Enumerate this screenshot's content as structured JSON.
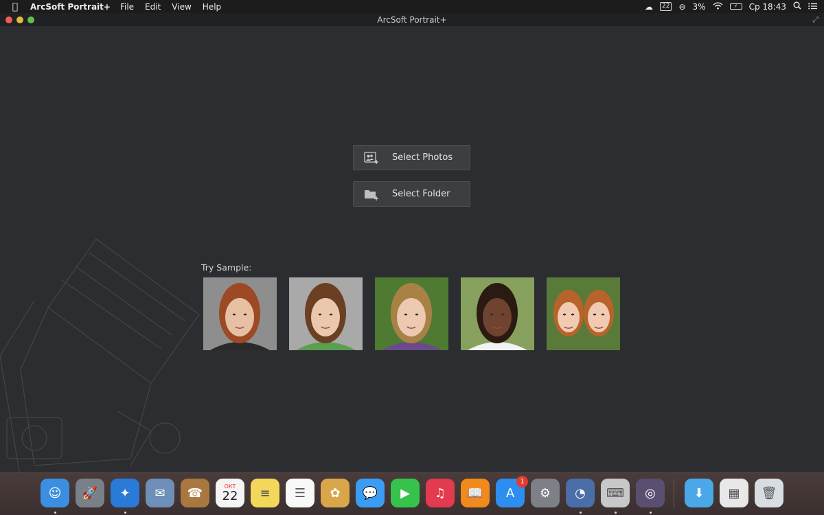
{
  "menubar": {
    "apple_icon": "",
    "app_name": "ArcSoft Portrait+",
    "menus": [
      "File",
      "Edit",
      "View",
      "Help"
    ],
    "status": {
      "calendar_badge": "22",
      "battery_percent": "3%",
      "clock": "Ср 18:43"
    }
  },
  "window": {
    "title": "ArcSoft Portrait+"
  },
  "main": {
    "select_photos_label": "Select Photos",
    "select_folder_label": "Select Folder",
    "try_sample_label": "Try Sample:",
    "samples": [
      {
        "name": "sample-woman-red-hair",
        "bg": "#8e8e8e",
        "hair": "#9c4a26",
        "skin": "#e7c0a3"
      },
      {
        "name": "sample-boy-brown-hair",
        "bg": "#a9a9a9",
        "hair": "#6b3f22",
        "skin": "#ebc7ad"
      },
      {
        "name": "sample-girl-blonde",
        "bg": "#4e7a32",
        "hair": "#a88245",
        "skin": "#ecc9b0"
      },
      {
        "name": "sample-girl-smiling",
        "bg": "#88a05e",
        "hair": "#2a1a12",
        "skin": "#6e4330"
      },
      {
        "name": "sample-two-girls",
        "bg": "#5a7a3a",
        "hair": "#b8632c",
        "skin": "#f0cbb2"
      }
    ]
  },
  "dock": {
    "calendar_month": "ОКТ",
    "calendar_day": "22",
    "app_store_badge": "1",
    "apps": [
      {
        "name": "finder",
        "color": "#3c8ee0",
        "glyph": "☺"
      },
      {
        "name": "launchpad",
        "color": "#7a8088",
        "glyph": "🚀"
      },
      {
        "name": "safari",
        "color": "#2a7ad8",
        "glyph": "✦"
      },
      {
        "name": "mail",
        "color": "#6d8fb8",
        "glyph": "✉"
      },
      {
        "name": "contacts",
        "color": "#a8783f",
        "glyph": "☎"
      },
      {
        "name": "calendar",
        "color": "#f4f4f4",
        "glyph": ""
      },
      {
        "name": "notes",
        "color": "#f3d75a",
        "glyph": "≡"
      },
      {
        "name": "reminders",
        "color": "#f8f8f8",
        "glyph": "☰"
      },
      {
        "name": "photos",
        "color": "#d9a64a",
        "glyph": "✿"
      },
      {
        "name": "messages",
        "color": "#3a9df5",
        "glyph": "💬"
      },
      {
        "name": "facetime",
        "color": "#37c24c",
        "glyph": "▶"
      },
      {
        "name": "itunes",
        "color": "#e23a4e",
        "glyph": "♫"
      },
      {
        "name": "ibooks",
        "color": "#f08a1c",
        "glyph": "📖"
      },
      {
        "name": "app-store",
        "color": "#2d8ef0",
        "glyph": "A"
      },
      {
        "name": "system-preferences",
        "color": "#7d8087",
        "glyph": "⚙"
      },
      {
        "name": "dashboard",
        "color": "#4a6ea8",
        "glyph": "◔"
      },
      {
        "name": "keychain",
        "color": "#c8c8c8",
        "glyph": "⌨"
      },
      {
        "name": "arcsoft-portrait",
        "color": "#5a4f70",
        "glyph": "◎"
      },
      {
        "name": "downloads-folder",
        "color": "#4aa8e8",
        "glyph": "⬇"
      },
      {
        "name": "documents-stack",
        "color": "#e8e8e8",
        "glyph": "▦"
      },
      {
        "name": "trash",
        "color": "#d8dde2",
        "glyph": "🗑"
      }
    ]
  }
}
